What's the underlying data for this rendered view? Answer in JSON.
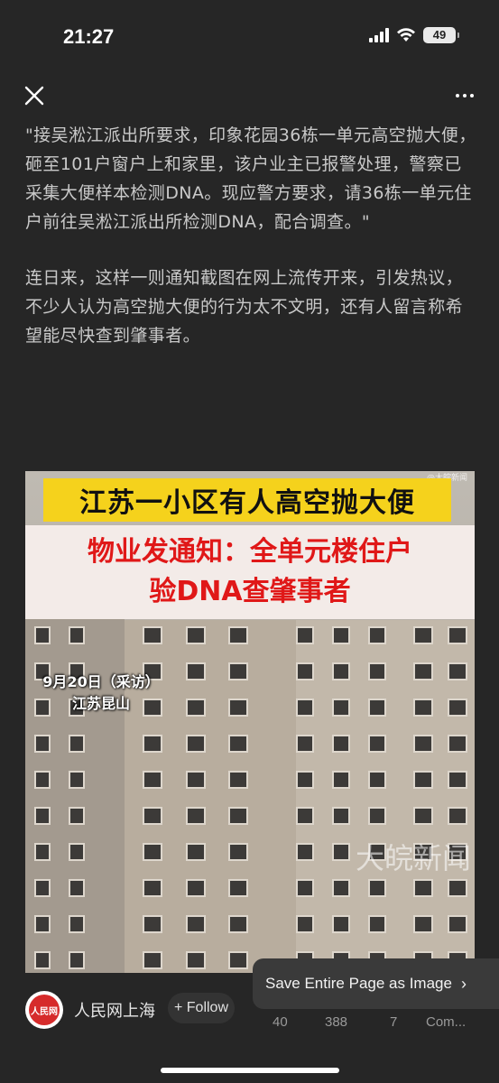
{
  "status": {
    "time": "21:27",
    "battery": "49"
  },
  "nav": {
    "close_icon": "close-icon",
    "more_icon": "more-icon"
  },
  "article": {
    "paragraphs": [
      "\"接吴淞江派出所要求，印象花园36栋一单元高空抛大便，砸至101户窗户上和家里，该户业主已报警处理，警察已采集大便样本检测DNA。现应警方要求，请36栋一单元住户前往吴淞江派出所检测DNA，配合调查。\"",
      "连日来，这样一则通知截图在网上流传开来，引发热议，不少人认为高空抛大便的行为太不文明，还有人留言称希望能尽快查到肇事者。"
    ]
  },
  "image": {
    "banner_title": "江苏一小区有人高空抛大便",
    "subtitle_line1": "物业发通知：全单元楼住户",
    "subtitle_line2": "验DNA查肇事者",
    "date_line1": "9月20日（采访）",
    "date_line2": "江苏昆山",
    "watermark": "大皖新闻",
    "watermark_small": "@大皖新闻"
  },
  "footer": {
    "source_name": "人民网上海",
    "avatar_text": "人民网",
    "follow_label": "+ Follow",
    "stats": [
      "40",
      "388",
      "7",
      "Com..."
    ],
    "save_popup": "Save Entire Page as Image"
  }
}
